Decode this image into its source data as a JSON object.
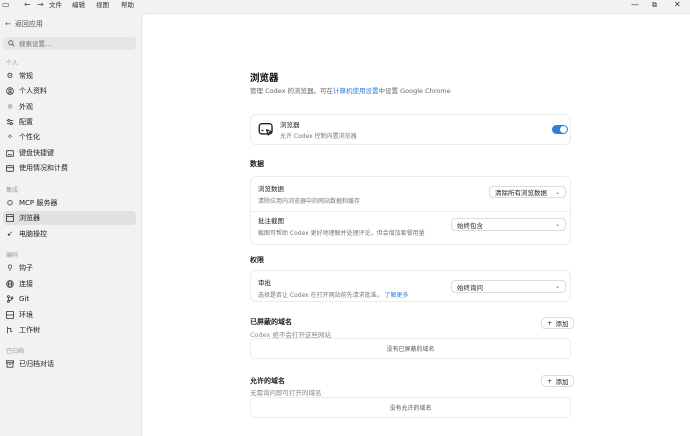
{
  "titlebar": {
    "menus": [
      "文件",
      "编辑",
      "视图",
      "帮助"
    ]
  },
  "sidebar": {
    "back_label": "返回应用",
    "search_placeholder": "搜索设置...",
    "sections": [
      {
        "label": "个人",
        "items": [
          "常规",
          "个人资料",
          "外观",
          "配置",
          "个性化",
          "键盘快捷键",
          "使用情况和计费"
        ]
      },
      {
        "label": "集成",
        "items": [
          "MCP 服务器",
          "浏览器",
          "电脑操控"
        ]
      },
      {
        "label": "编码",
        "items": [
          "钩子",
          "连接",
          "Git",
          "环境",
          "工作树"
        ]
      },
      {
        "label": "已归档",
        "items": [
          "已归档对话"
        ]
      }
    ],
    "active_item": "浏览器"
  },
  "main": {
    "title": "浏览器",
    "desc_pre": "管理 Codex 的浏览器。可在",
    "desc_link": "计算机使用设置",
    "desc_post": "中设置 Google Chrome",
    "browser_card": {
      "title": "浏览器",
      "desc": "允许 Codex 控制内置浏览器",
      "enabled": true
    },
    "data_section": {
      "heading": "数据",
      "browse_data_title": "浏览数据",
      "browse_data_desc": "清除应用内浏览器中的网站数据和缓存",
      "clear_button": "清除所有浏览数据",
      "screenshot_title": "批注截图",
      "screenshot_desc": "截图可帮助 Codex 更好地理解并处理评论，但会增加套餐用量",
      "screenshot_value": "始终包含"
    },
    "permissions_section": {
      "heading": "权限",
      "approval_title": "审批",
      "approval_desc": "选择是否让 Codex 在打开网站前先请求批准。",
      "approval_link": "了解更多",
      "approval_value": "始终询问"
    },
    "blocked": {
      "heading": "已屏蔽的域名",
      "sub": "Codex 绝不会打开这些网站",
      "add_label": "添加",
      "empty": "没有已屏蔽的域名"
    },
    "allowed": {
      "heading": "允许的域名",
      "sub": "无需询问即可打开的域名",
      "add_label": "添加",
      "empty": "没有允许的域名"
    }
  },
  "colors": {
    "accent": "#2f7ddc",
    "sidebar_bg": "#f2f2f2",
    "active_item_bg": "#e2e2e2"
  }
}
